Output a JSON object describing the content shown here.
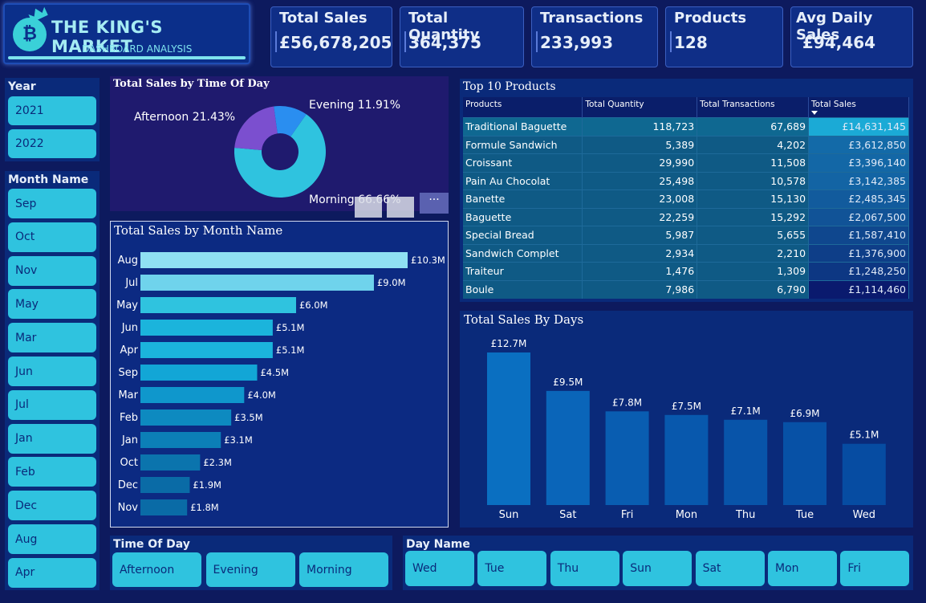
{
  "logo": {
    "title": "THE KING'S MARKET",
    "subtitle": "DASHBOARD ANALYSIS",
    "coin_symbol": "₿"
  },
  "kpis": [
    {
      "label": "Total Sales",
      "value": "£56,678,205"
    },
    {
      "label": "Total Quantity",
      "value": "364,375"
    },
    {
      "label": "Transactions",
      "value": "233,993"
    },
    {
      "label": "Products",
      "value": "128"
    },
    {
      "label": "Avg Daily Sales",
      "value": "£94,464"
    }
  ],
  "slicers": {
    "year": {
      "title": "Year",
      "items": [
        "2021",
        "2022"
      ]
    },
    "month": {
      "title": "Month Name",
      "items": [
        "Sep",
        "Oct",
        "Nov",
        "May",
        "Mar",
        "Jun",
        "Jul",
        "Jan",
        "Feb",
        "Dec",
        "Aug",
        "Apr"
      ]
    },
    "time_of_day": {
      "title": "Time Of Day",
      "items": [
        "Afternoon",
        "Evening",
        "Morning"
      ]
    },
    "day_name": {
      "title": "Day Name",
      "items": [
        "Wed",
        "Tue",
        "Thu",
        "Sun",
        "Sat",
        "Mon",
        "Fri"
      ]
    }
  },
  "colors": {
    "accent": "#2fc3df",
    "background": "#0d1a5e"
  },
  "chart_data": [
    {
      "type": "pie",
      "title": "Total Sales by Time Of Day",
      "slices": [
        {
          "label": "Morning",
          "value": 66.66,
          "display": "Morning 66.66%",
          "color": "#2fc3df"
        },
        {
          "label": "Afternoon",
          "value": 21.43,
          "display": "Afternoon 21.43%",
          "color": "#7b4fcf"
        },
        {
          "label": "Evening",
          "value": 11.91,
          "display": "Evening 11.91%",
          "color": "#2a8ef0"
        }
      ]
    },
    {
      "type": "bar",
      "orientation": "horizontal",
      "title": "Total Sales by Month Name",
      "categories": [
        "Aug",
        "Jul",
        "May",
        "Jun",
        "Apr",
        "Sep",
        "Mar",
        "Feb",
        "Jan",
        "Oct",
        "Dec",
        "Nov"
      ],
      "values": [
        10.3,
        9.0,
        6.0,
        5.1,
        5.1,
        4.5,
        4.0,
        3.5,
        3.1,
        2.3,
        1.9,
        1.8
      ],
      "labels": [
        "£10.3M",
        "£9.0M",
        "£6.0M",
        "£5.1M",
        "£5.1M",
        "£4.5M",
        "£4.0M",
        "£3.5M",
        "£3.1M",
        "£2.3M",
        "£1.9M",
        "£1.8M"
      ],
      "unit": "£M"
    },
    {
      "type": "table",
      "title": "Top 10 Products",
      "columns": [
        "Products",
        "Total Quantity",
        "Total Transactions",
        "Total Sales"
      ],
      "rows": [
        [
          "Traditional Baguette",
          "118,723",
          "67,689",
          "£14,631,145"
        ],
        [
          "Formule Sandwich",
          "5,389",
          "4,202",
          "£3,612,850"
        ],
        [
          "Croissant",
          "29,990",
          "11,508",
          "£3,396,140"
        ],
        [
          "Pain Au Chocolat",
          "25,498",
          "10,578",
          "£3,142,385"
        ],
        [
          "Banette",
          "23,008",
          "15,130",
          "£2,485,345"
        ],
        [
          "Baguette",
          "22,259",
          "15,292",
          "£2,067,500"
        ],
        [
          "Special Bread",
          "5,987",
          "5,655",
          "£1,587,410"
        ],
        [
          "Sandwich Complet",
          "2,934",
          "2,210",
          "£1,376,900"
        ],
        [
          "Traiteur",
          "1,476",
          "1,309",
          "£1,248,250"
        ],
        [
          "Boule",
          "7,986",
          "6,790",
          "£1,114,460"
        ]
      ],
      "sales_values": [
        14631145,
        3612850,
        3396140,
        3142385,
        2485345,
        2067500,
        1587410,
        1376900,
        1248250,
        1114460
      ],
      "sort": {
        "column": "Total Sales",
        "direction": "desc"
      }
    },
    {
      "type": "bar",
      "orientation": "vertical",
      "title": "Total Sales By Days",
      "categories": [
        "Sun",
        "Sat",
        "Fri",
        "Mon",
        "Thu",
        "Tue",
        "Wed"
      ],
      "values": [
        12.7,
        9.5,
        7.8,
        7.5,
        7.1,
        6.9,
        5.1
      ],
      "labels": [
        "£12.7M",
        "£9.5M",
        "£7.8M",
        "£7.5M",
        "£7.1M",
        "£6.9M",
        "£5.1M"
      ],
      "unit": "£M"
    }
  ]
}
